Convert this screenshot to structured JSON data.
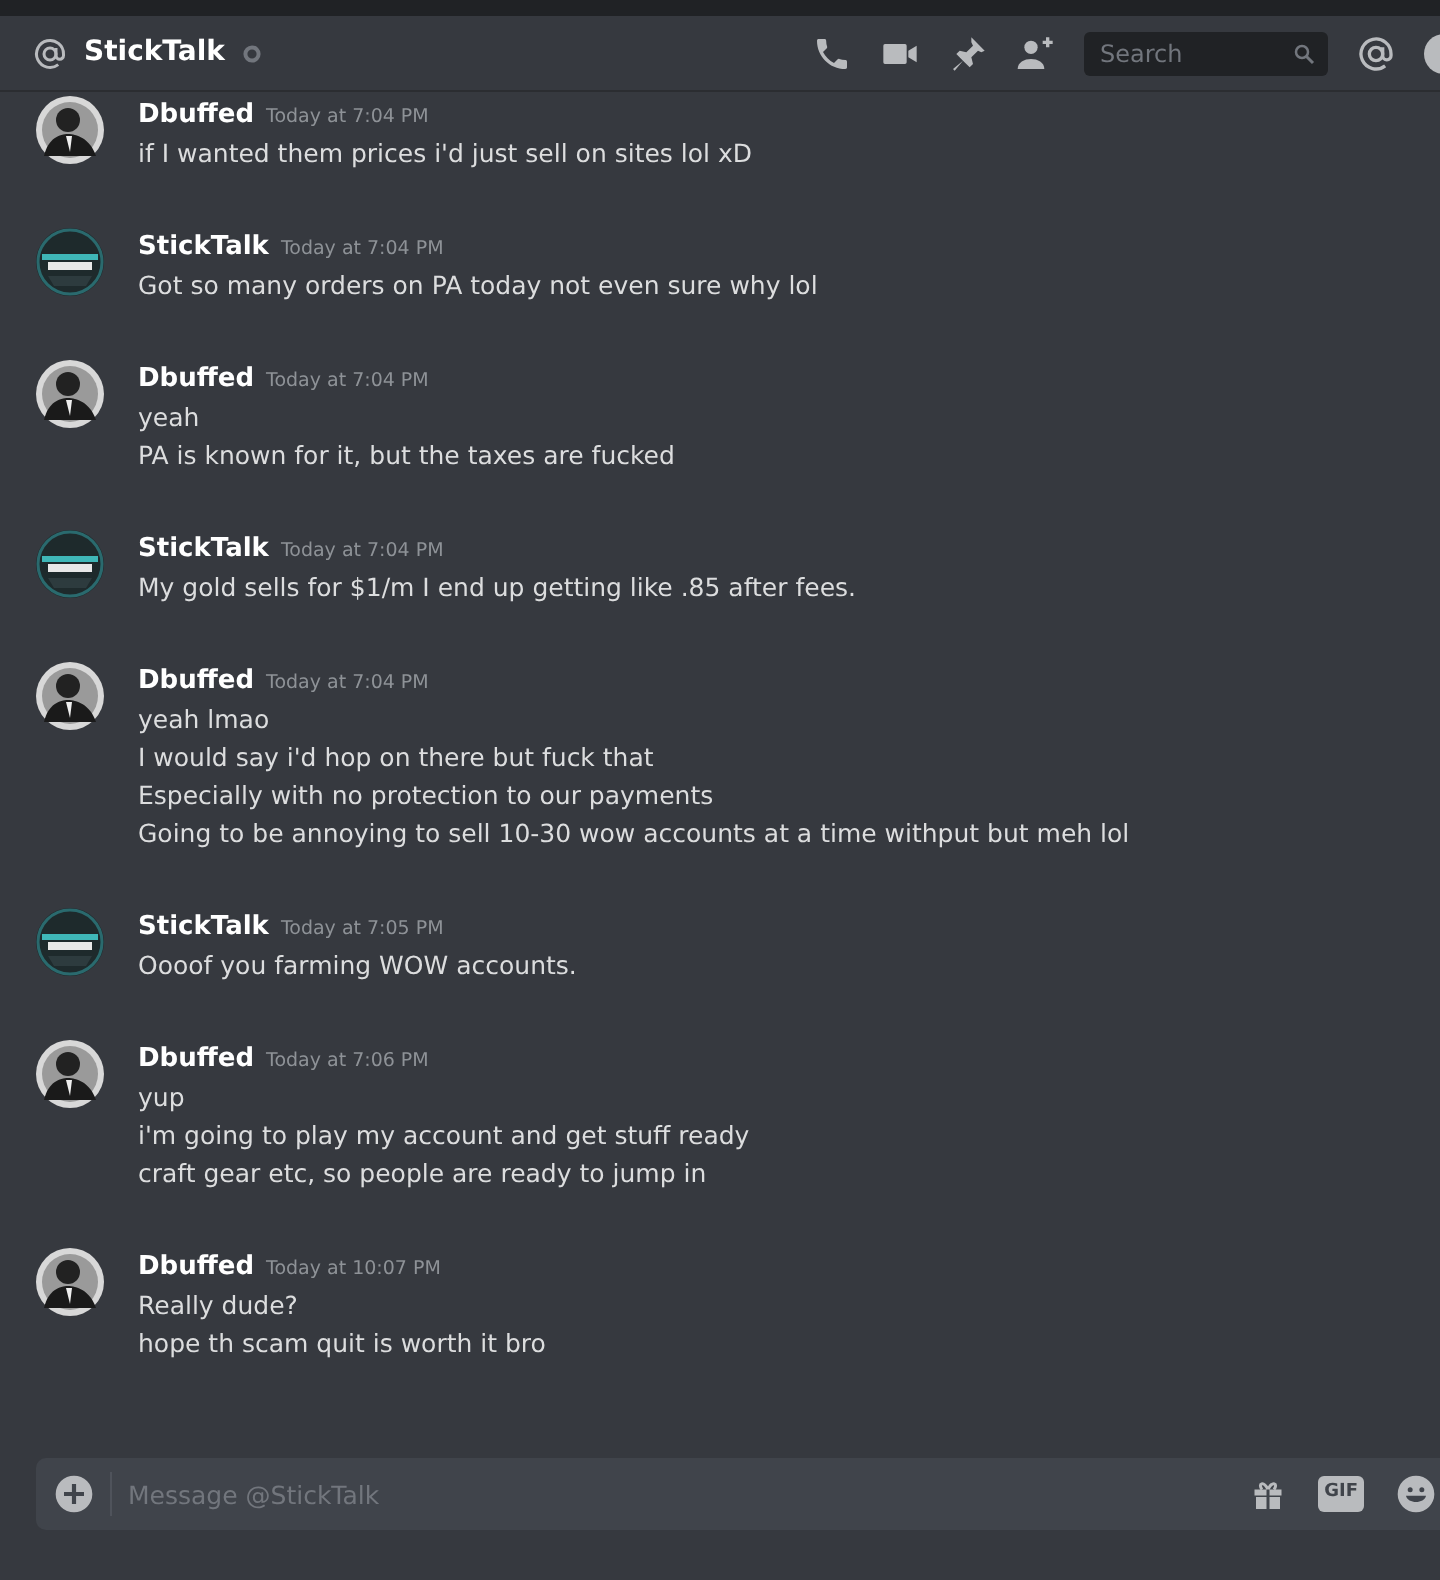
{
  "header": {
    "title": "StickTalk",
    "search": {
      "placeholder": "Search"
    }
  },
  "messages": [
    {
      "author": "Dbuffed",
      "time": "Today at 7:04 PM",
      "kind": "person",
      "lines": [
        "if I wanted them prices i'd just sell on sites lol xD"
      ]
    },
    {
      "author": "StickTalk",
      "time": "Today at 7:04 PM",
      "kind": "logo",
      "lines": [
        "Got so many orders on PA today not even sure why lol"
      ]
    },
    {
      "author": "Dbuffed",
      "time": "Today at 7:04 PM",
      "kind": "person",
      "lines": [
        "yeah",
        "PA is known for it, but the taxes are fucked"
      ]
    },
    {
      "author": "StickTalk",
      "time": "Today at 7:04 PM",
      "kind": "logo",
      "lines": [
        "My gold sells for $1/m I end up getting like .85 after fees."
      ]
    },
    {
      "author": "Dbuffed",
      "time": "Today at 7:04 PM",
      "kind": "person",
      "lines": [
        "yeah lmao",
        "I would say i'd hop on there but fuck that",
        "Especially with no protection to our payments",
        "Going to be annoying to sell 10-30 wow accounts at a time withput but meh lol"
      ]
    },
    {
      "author": "StickTalk",
      "time": "Today at 7:05 PM",
      "kind": "logo",
      "lines": [
        "Oooof you farming WOW accounts."
      ]
    },
    {
      "author": "Dbuffed",
      "time": "Today at 7:06 PM",
      "kind": "person",
      "lines": [
        "yup",
        "i'm going to play my account and get stuff ready",
        "craft gear etc, so people are ready to jump in"
      ]
    },
    {
      "author": "Dbuffed",
      "time": "Today at 10:07 PM",
      "kind": "person",
      "lines": [
        "Really dude?",
        "hope th scam quit is worth it bro"
      ]
    }
  ],
  "composer": {
    "placeholder": "Message @StickTalk",
    "gif_label": "GIF"
  }
}
